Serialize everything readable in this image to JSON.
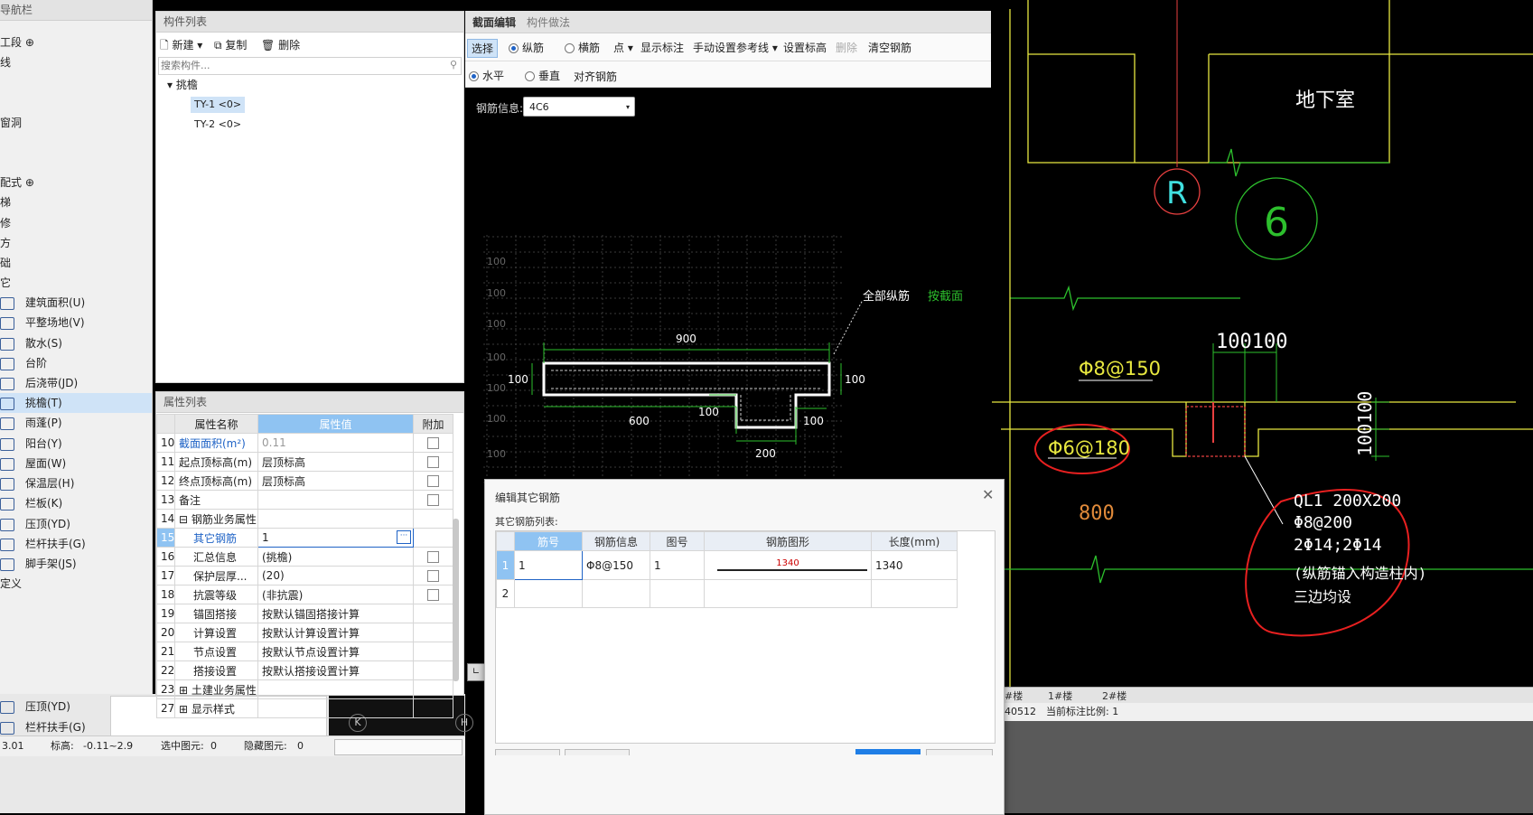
{
  "nav": {
    "title": "导航栏",
    "items": [
      "工段",
      "线",
      "窗洞",
      "配式",
      "梯",
      "修",
      "方",
      "础",
      "它",
      "建筑面积(U)",
      "平整场地(V)",
      "散水(S)",
      "台阶",
      "后浇带(JD)",
      "挑檐(T)",
      "雨蓬(P)",
      "阳台(Y)",
      "屋面(W)",
      "保温层(H)",
      "栏板(K)",
      "压顶(YD)",
      "栏杆扶手(G)",
      "脚手架(JS)",
      "定义"
    ],
    "lower_items": [
      "压顶(YD)",
      "栏杆扶手(G)"
    ]
  },
  "component_list": {
    "title": "构件列表",
    "new_label": "新建",
    "copy_label": "复制",
    "delete_label": "删除",
    "search_placeholder": "搜索构件...",
    "tree_root": "挑檐",
    "items": [
      "TY-1 <0>",
      "TY-2 <0>"
    ]
  },
  "properties": {
    "title": "属性列表",
    "col_name": "属性名称",
    "col_value": "属性值",
    "col_extra": "附加",
    "rows": [
      {
        "num": "10",
        "name": "截面面积(m²)",
        "value": "0.11"
      },
      {
        "num": "11",
        "name": "起点顶标高(m)",
        "value": "层顶标高"
      },
      {
        "num": "12",
        "name": "终点顶标高(m)",
        "value": "层顶标高"
      },
      {
        "num": "13",
        "name": "备注",
        "value": ""
      },
      {
        "num": "14",
        "name": "钢筋业务属性",
        "value": ""
      },
      {
        "num": "15",
        "name": "其它钢筋",
        "value": "1"
      },
      {
        "num": "16",
        "name": "汇总信息",
        "value": "(挑檐)"
      },
      {
        "num": "17",
        "name": "保护层厚...",
        "value": "(20)"
      },
      {
        "num": "18",
        "name": "抗震等级",
        "value": "(非抗震)"
      },
      {
        "num": "19",
        "name": "锚固搭接",
        "value": "按默认锚固搭接计算"
      },
      {
        "num": "20",
        "name": "计算设置",
        "value": "按默认计算设置计算"
      },
      {
        "num": "21",
        "name": "节点设置",
        "value": "按默认节点设置计算"
      },
      {
        "num": "22",
        "name": "搭接设置",
        "value": "按默认搭接设置计算"
      },
      {
        "num": "23",
        "name": "土建业务属性",
        "value": ""
      },
      {
        "num": "27",
        "name": "显示样式",
        "value": ""
      }
    ]
  },
  "section_editor": {
    "tab_active": "截面编辑",
    "tab_other": "构件做法",
    "toolbar": [
      "选择",
      "纵筋",
      "横筋",
      "点",
      "显示标注",
      "手动设置参考线",
      "设置标高",
      "删除",
      "清空钢筋"
    ],
    "toolbar2": [
      "水平",
      "垂直",
      "对齐钢筋"
    ],
    "rebar_label": "钢筋信息:",
    "rebar_value": "4C6",
    "grid_label": "100",
    "dims": {
      "top": "900",
      "left": "100",
      "right": "100",
      "bottom_left": "600",
      "step_left": "100",
      "step_right": "100",
      "bottom": "200"
    },
    "annotation_1": "全部纵筋",
    "annotation_2": "按截面"
  },
  "dialog": {
    "title": "编辑其它钢筋",
    "subtitle": "其它钢筋列表:",
    "columns": [
      "筋号",
      "钢筋信息",
      "图号",
      "钢筋图形",
      "长度(mm)"
    ],
    "rows": [
      {
        "num": "1",
        "bar": "1",
        "info": "Φ8@150",
        "fig": "1",
        "shape": "1340",
        "length": "1340"
      },
      {
        "num": "2",
        "bar": "",
        "info": "",
        "fig": "",
        "shape": "",
        "length": ""
      }
    ]
  },
  "cad": {
    "basement": "地下室",
    "axis_r": "R",
    "axis_6": "6",
    "dim_100_100": "100100",
    "rebar_1": "Φ8@150",
    "rebar_2": "Φ6@180",
    "dim_800": "800",
    "dim_vert": "100100",
    "ql_1": "QL1 200X200",
    "ql_2": "Φ8@200",
    "ql_3": "2Φ14;2Φ14",
    "ql_4": "(纵筋锚入构造柱内)",
    "ql_5": "三边均设",
    "floor_tabs": [
      "#楼",
      "1#楼",
      "2#楼"
    ],
    "status_coord": "40512",
    "status_scale": "当前标注比例: 1"
  },
  "status_bar": {
    "value_1": "3.01",
    "elev_label": "标高:",
    "elev_value": "-0.11~2.9",
    "selected_label": "选中图元:",
    "selected_value": "0",
    "hidden_label": "隐藏图元:",
    "hidden_value": "0"
  }
}
